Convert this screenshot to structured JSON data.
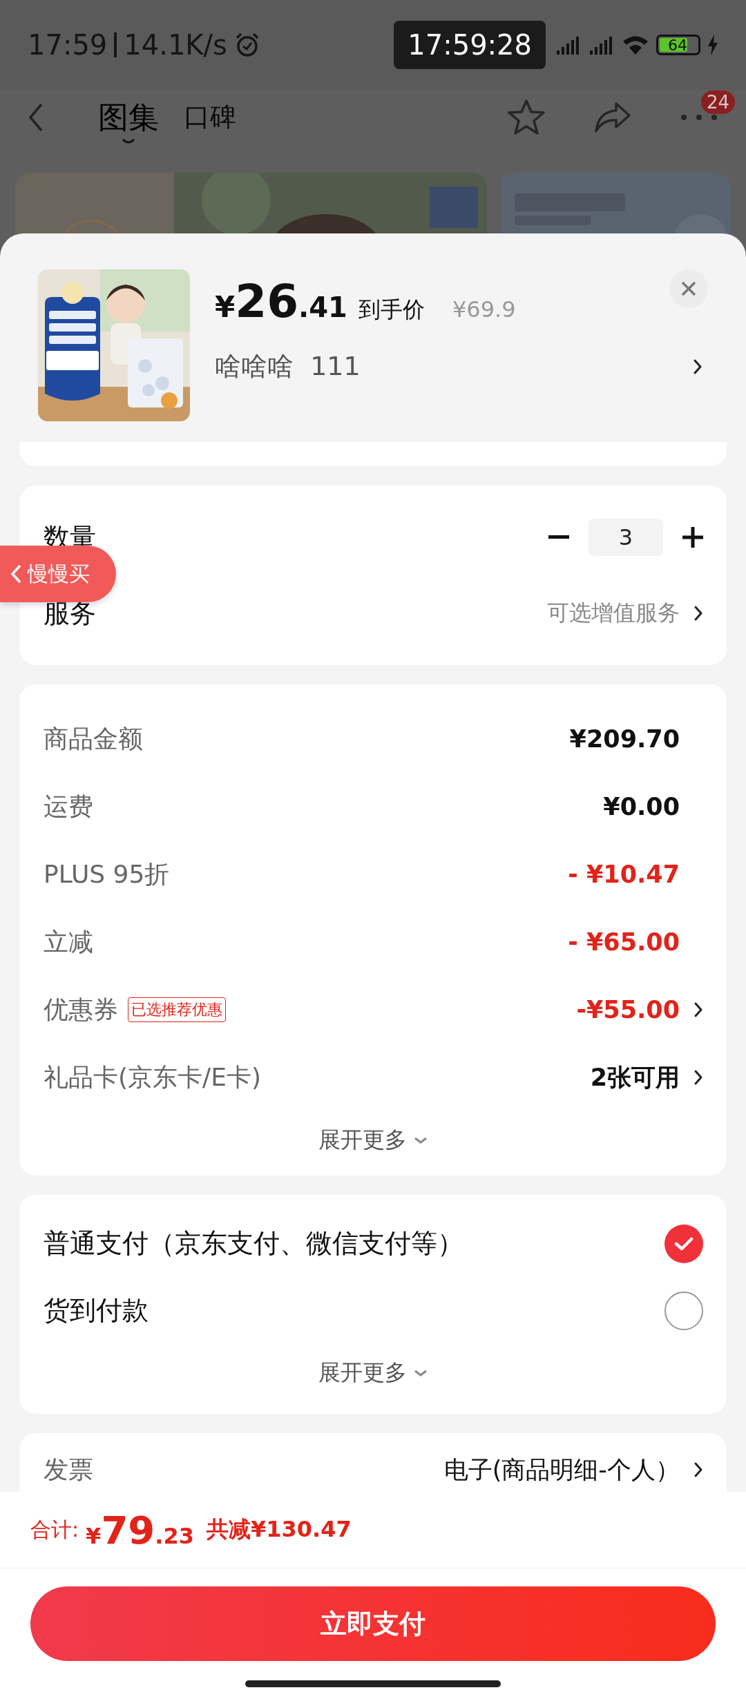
{
  "status_bar": {
    "time": "17:59",
    "speed": "14.1K/s",
    "floating_clock": "17:59:28",
    "battery": "64"
  },
  "nav": {
    "tabs": [
      {
        "label": "图集",
        "selected": true
      },
      {
        "label": "口碑",
        "selected": false
      }
    ],
    "badge": "24"
  },
  "product": {
    "price": {
      "symbol": "¥",
      "integer": "26",
      "decimal": ".41"
    },
    "price_label": "到手价",
    "original_price": "¥69.9",
    "variant": "啥啥啥  111"
  },
  "quantity": {
    "label": "数量",
    "value": "3"
  },
  "service": {
    "label": "服务",
    "value": "可选增值服务"
  },
  "float_tag": "慢慢买",
  "costs": [
    {
      "label": "商品金额",
      "value": "¥209.70",
      "discount": false,
      "arrow": false
    },
    {
      "label": "运费",
      "value": "¥0.00",
      "discount": false,
      "arrow": false
    },
    {
      "label": "PLUS 95折",
      "value": "- ¥10.47",
      "discount": true,
      "arrow": false
    },
    {
      "label": "立减",
      "value": "- ¥65.00",
      "discount": true,
      "arrow": false
    },
    {
      "label": "优惠券",
      "tag": "已选推荐优惠",
      "value": "-¥55.00",
      "discount": true,
      "arrow": true
    },
    {
      "label": "礼品卡(京东卡/E卡)",
      "value": "2张可用",
      "discount": false,
      "arrow": true
    }
  ],
  "costs_more": "展开更多",
  "payment": {
    "options": [
      {
        "label": "普通支付（京东支付、微信支付等）",
        "selected": true
      },
      {
        "label": "货到付款",
        "selected": false
      }
    ],
    "more": "展开更多"
  },
  "invoice": {
    "label": "发票",
    "value": "电子(商品明细-个人）"
  },
  "footer": {
    "total_label": "合计:",
    "total": {
      "symbol": "¥",
      "integer": "79",
      "decimal": ".23"
    },
    "savings": "共减¥130.47",
    "pay_button": "立即支付"
  }
}
